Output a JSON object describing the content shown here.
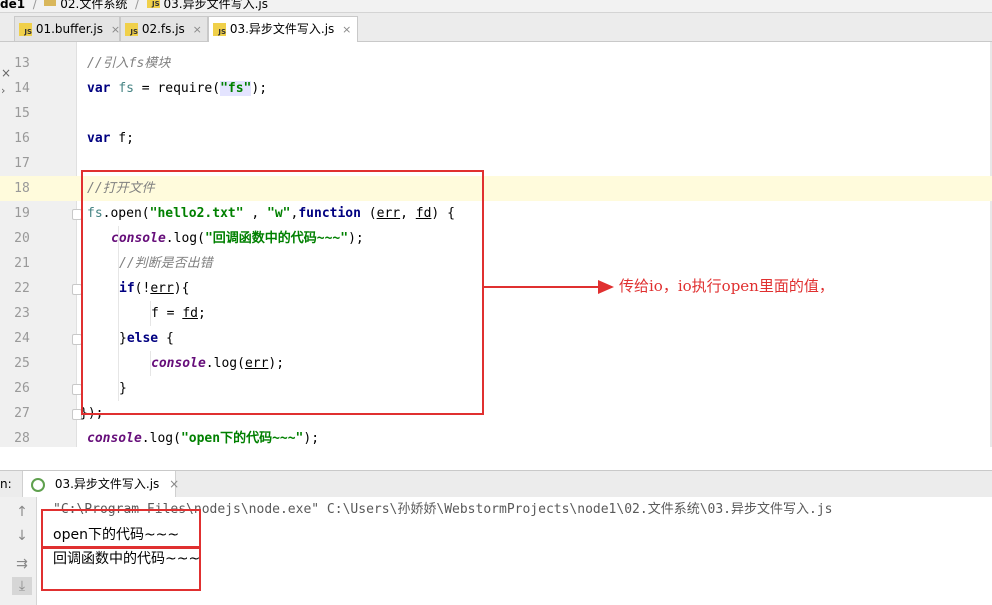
{
  "breadcrumb": {
    "project": "de1",
    "folder": "02.文件系统",
    "file": "03.异步文件写入.js"
  },
  "tabs": [
    {
      "label": "01.buffer.js",
      "active": false
    },
    {
      "label": "02.fs.js",
      "active": false
    },
    {
      "label": "03.异步文件写入.js",
      "active": true
    }
  ],
  "tab_close": "×",
  "js_badge": "JS",
  "editor": {
    "lines": [
      {
        "num": "13"
      },
      {
        "num": "14"
      },
      {
        "num": "15"
      },
      {
        "num": "16"
      },
      {
        "num": "17"
      },
      {
        "num": "18"
      },
      {
        "num": "19"
      },
      {
        "num": "20"
      },
      {
        "num": "21"
      },
      {
        "num": "22"
      },
      {
        "num": "23"
      },
      {
        "num": "24"
      },
      {
        "num": "25"
      },
      {
        "num": "26"
      },
      {
        "num": "27"
      },
      {
        "num": "28"
      }
    ],
    "code": {
      "l13_comment": "//引入fs模块",
      "l14_kw": "var",
      "l14_var": "fs",
      "l14_eq": " = require(",
      "l14_str": "\"fs\"",
      "l14_end": ");",
      "l16_kw": "var",
      "l16_rest": " f;",
      "l18_comment": "//打开文件",
      "l19_fs": "fs",
      "l19_open": ".open(",
      "l19_str1": "\"hello2.txt\"",
      "l19_sep": " , ",
      "l19_str2": "\"w\"",
      "l19_comma": ",",
      "l19_kw": "function",
      "l19_p1": " (",
      "l19_err": "err",
      "l19_p2": ", ",
      "l19_fd": "fd",
      "l19_p3": ") {",
      "l20_obj": "console",
      "l20_log": ".log(",
      "l20_str": "\"回调函数中的代码~~~\"",
      "l20_end": ");",
      "l21_comment": "//判断是否出错",
      "l22_kw": "if",
      "l22_p1": "(!",
      "l22_err": "err",
      "l22_p2": "){",
      "l23_f": "f = ",
      "l23_fd": "fd",
      "l23_end": ";",
      "l24_p1": "}",
      "l24_kw": "else",
      "l24_p2": " {",
      "l25_obj": "console",
      "l25_log": ".log(",
      "l25_err": "err",
      "l25_end": ");",
      "l26": "}",
      "l27": "});",
      "l28_obj": "console",
      "l28_log": ".log(",
      "l28_str": "\"open下的代码~~~\"",
      "l28_end": ");"
    }
  },
  "annotation": "传给io，io执行open里面的值，",
  "run_panel": {
    "label": "n:",
    "tab": "03.异步文件写入.js",
    "tab_close": "×",
    "console_lines": [
      "\"C:\\Program Files\\nodejs\\node.exe\" C:\\Users\\孙娇娇\\WebstormProjects\\node1\\02.文件系统\\03.异步文件写入.js",
      "open下的代码~~~",
      "回调函数中的代码~~~"
    ]
  },
  "colors": {
    "annotation_red": "#e03030",
    "current_line": "#fffbdc",
    "keyword": "#000080",
    "string": "#008000",
    "comment": "#808080"
  }
}
